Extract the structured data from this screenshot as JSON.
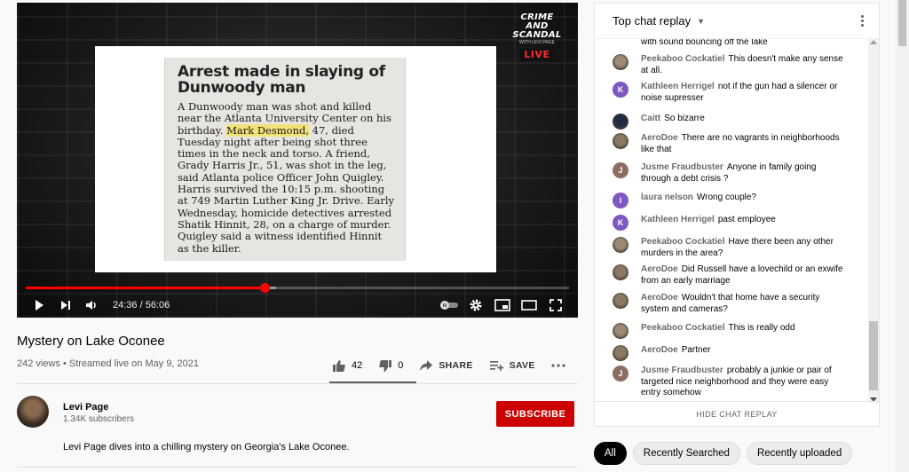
{
  "player": {
    "time": "24:36 / 56:06",
    "progress_fraction": 0.44,
    "loaded_fraction": 0.46,
    "brand": {
      "line1": "CRIME",
      "line2": "AND",
      "line3": "SCANDAL",
      "small": "WITH LEVI PAGE",
      "live": "LIVE"
    },
    "clipping": {
      "headline": "Arrest made in slaying of Dunwoody man",
      "body_before": "A Dunwoody man was shot and killed near the Atlanta University Center on his birthday. ",
      "highlight": "Mark Desmond,",
      "body_after": " 47, died Tuesday night after being shot three times in the neck and torso. A friend, Grady Harris Jr., 51, was shot in the leg, said Atlanta police Officer John Quigley. Harris survived the 10:15 p.m. shooting at 749 Martin Luther King Jr. Drive. Early Wednesday, homicide detectives arrested Shatik Hinnit, 28, on a charge of murder. Quigley said a witness identified Hinnit as the killer."
    }
  },
  "video": {
    "title": "Mystery on Lake Oconee",
    "meta": "242 views • Streamed live on May 9, 2021",
    "likes": "42",
    "dislikes": "0",
    "like_ratio": 1.0,
    "share_label": "SHARE",
    "save_label": "SAVE"
  },
  "channel": {
    "name": "Levi Page",
    "subscribers": "1.34K subscribers",
    "subscribe_label": "SUBSCRIBE",
    "description": "Levi Page dives into a chilling mystery on Georgia's Lake Oconee."
  },
  "chat": {
    "title": "Top chat replay",
    "hide_label": "HIDE CHAT REPLAY",
    "partial_top": "with sound bouncing off the lake",
    "messages": [
      {
        "author": "Peekaboo Cockatiel",
        "text": "This doesn't make any sense at all.",
        "avatar": "photo",
        "color": "#9c8a76"
      },
      {
        "author": "Kathleen Herrigel",
        "text": "not if the gun had a silencer or noise supresser",
        "avatar": "K",
        "color": "#7e57c2"
      },
      {
        "author": "Caitt",
        "text": "So bizarre",
        "avatar": "photo",
        "color": "#1f2a44"
      },
      {
        "author": "AeroDoe",
        "text": "There are no vagrants in neighborhoods like that",
        "avatar": "photo",
        "color": "#8a7a62"
      },
      {
        "author": "Jusme Fraudbuster",
        "text": "Anyone in family going through a debt crisis ?",
        "avatar": "J",
        "color": "#8d6e63"
      },
      {
        "author": "laura nelson",
        "text": "Wrong couple?",
        "avatar": "l",
        "color": "#7e57c2"
      },
      {
        "author": "Kathleen Herrigel",
        "text": "past employee",
        "avatar": "K",
        "color": "#7e57c2"
      },
      {
        "author": "Peekaboo Cockatiel",
        "text": "Have there been any other murders in the area?",
        "avatar": "photo",
        "color": "#9c8a76"
      },
      {
        "author": "AeroDoe",
        "text": "Did Russell have a lovechild or an exwife from an early marriage",
        "avatar": "photo",
        "color": "#8a7a62"
      },
      {
        "author": "AeroDoe",
        "text": "Wouldn't that home have a security system and cameras?",
        "avatar": "photo",
        "color": "#8a7a62"
      },
      {
        "author": "Peekaboo Cockatiel",
        "text": "This is really odd",
        "avatar": "photo",
        "color": "#9c8a76"
      },
      {
        "author": "AeroDoe",
        "text": "Partner",
        "avatar": "photo",
        "color": "#8a7a62"
      },
      {
        "author": "Jusme Fraudbuster",
        "text": "probably a junkie or pair of targeted nice neighborhood and they were easy entry somehow",
        "avatar": "J",
        "color": "#8d6e63"
      }
    ]
  },
  "chips": [
    "All",
    "Recently Searched",
    "Recently uploaded"
  ],
  "colors": {
    "accent": "#cc0000",
    "progress": "#ff0000"
  }
}
